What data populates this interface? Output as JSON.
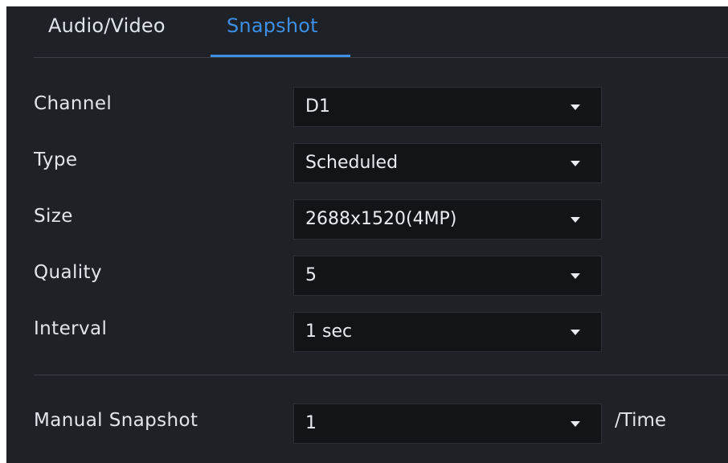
{
  "tabs": [
    {
      "label": "Audio/Video",
      "active": false
    },
    {
      "label": "Snapshot",
      "active": true
    }
  ],
  "fields": {
    "channel": {
      "label": "Channel",
      "value": "D1"
    },
    "type": {
      "label": "Type",
      "value": "Scheduled"
    },
    "size": {
      "label": "Size",
      "value": "2688x1520(4MP)"
    },
    "quality": {
      "label": "Quality",
      "value": "5"
    },
    "interval": {
      "label": "Interval",
      "value": "1 sec"
    },
    "manual": {
      "label": "Manual Snapshot",
      "value": "1",
      "suffix": "/Time"
    }
  },
  "colors": {
    "background": "#1e2126",
    "accent": "#3d8fe6",
    "text": "#e2e5ea",
    "field_bg": "#121418"
  }
}
